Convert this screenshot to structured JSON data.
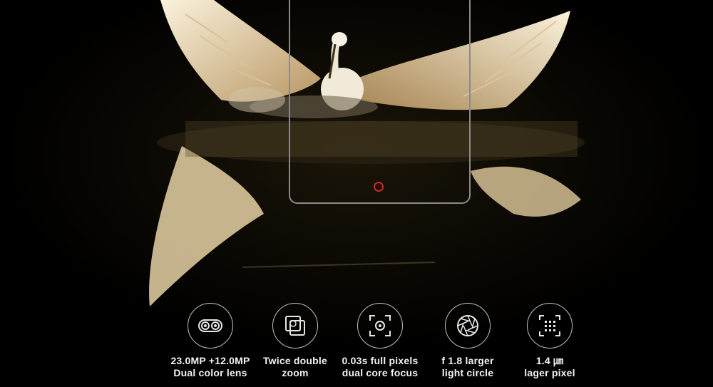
{
  "accent_color": "#d1262b",
  "hero": {
    "subject": "egret-photo",
    "home_button_icon": "home-button-ring-icon"
  },
  "features": [
    {
      "icon": "dual-camera-icon",
      "line1": "23.0MP +12.0MP",
      "line2": "Dual color lens"
    },
    {
      "icon": "zoom-icon",
      "line1": "Twice double",
      "line2": "zoom"
    },
    {
      "icon": "focus-icon",
      "line1": "0.03s full pixels",
      "line2": "dual core focus"
    },
    {
      "icon": "aperture-icon",
      "line1": "f 1.8 larger",
      "line2": "light circle"
    },
    {
      "icon": "pixel-grid-icon",
      "line1": "1.4 ㎛",
      "line2": "lager pixel"
    }
  ]
}
